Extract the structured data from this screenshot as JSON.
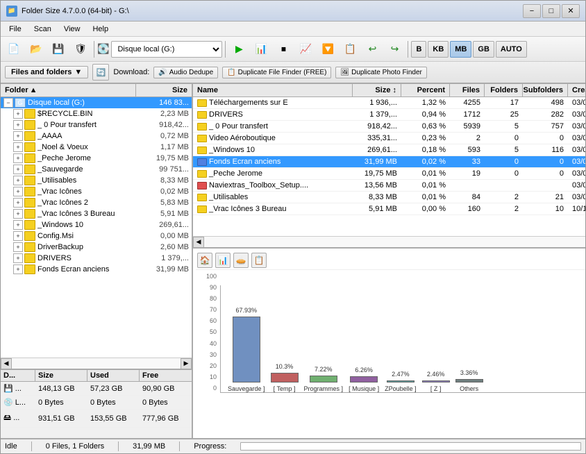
{
  "window": {
    "title": "Folder Size 4.7.0.0 (64-bit) - G:\\"
  },
  "menu": {
    "items": [
      "File",
      "Scan",
      "View",
      "Help"
    ]
  },
  "toolbar": {
    "drive_label": "Disque local (G:)",
    "size_buttons": [
      "B",
      "KB",
      "MB",
      "GB",
      "AUTO"
    ],
    "active_size": "MB"
  },
  "toolbar2": {
    "files_folders_label": "Files and folders",
    "download_label": "Download:",
    "tools": [
      {
        "icon": "🔊",
        "label": "Audio Dedupe"
      },
      {
        "icon": "📋",
        "label": "Duplicate File Finder (FREE)"
      },
      {
        "icon": "🖼",
        "label": "Duplicate Photo Finder"
      }
    ]
  },
  "tree": {
    "columns": [
      "Folder",
      "Size"
    ],
    "items": [
      {
        "indent": 0,
        "name": "Disque local (G:)",
        "size": "146 83...",
        "expanded": true,
        "selected": true,
        "type": "drive"
      },
      {
        "indent": 1,
        "name": "$RECYCLE.BIN",
        "size": "2,23 MB",
        "expanded": false,
        "type": "folder"
      },
      {
        "indent": 1,
        "name": "_ 0 Pour transfert",
        "size": "918,42...",
        "expanded": false,
        "type": "folder"
      },
      {
        "indent": 1,
        "name": "_AAAA",
        "size": "0,72 MB",
        "expanded": false,
        "type": "folder"
      },
      {
        "indent": 1,
        "name": "_Noel & Voeux",
        "size": "1,17 MB",
        "expanded": false,
        "type": "folder"
      },
      {
        "indent": 1,
        "name": "_Peche Jerome",
        "size": "19,75 MB",
        "expanded": false,
        "type": "folder"
      },
      {
        "indent": 1,
        "name": "_Sauvegarde",
        "size": "99 751...",
        "expanded": false,
        "type": "folder"
      },
      {
        "indent": 1,
        "name": "_Utilisables",
        "size": "8,33 MB",
        "expanded": false,
        "type": "folder"
      },
      {
        "indent": 1,
        "name": "_Vrac Icônes",
        "size": "0,02 MB",
        "expanded": false,
        "type": "folder"
      },
      {
        "indent": 1,
        "name": "_Vrac Icônes 2",
        "size": "5,83 MB",
        "expanded": false,
        "type": "folder"
      },
      {
        "indent": 1,
        "name": "_Vrac Icônes 3 Bureau",
        "size": "5,91 MB",
        "expanded": false,
        "type": "folder"
      },
      {
        "indent": 1,
        "name": "_Windows 10",
        "size": "269,61...",
        "expanded": false,
        "type": "folder"
      },
      {
        "indent": 1,
        "name": "Config.Msi",
        "size": "0,00 MB",
        "expanded": false,
        "type": "folder"
      },
      {
        "indent": 1,
        "name": "DriverBackup",
        "size": "2,60 MB",
        "expanded": false,
        "type": "folder"
      },
      {
        "indent": 1,
        "name": "DRIVERS",
        "size": "1 379,...",
        "expanded": false,
        "type": "folder"
      },
      {
        "indent": 1,
        "name": "Fonds Ecran anciens",
        "size": "31,99 MB",
        "expanded": false,
        "type": "folder"
      }
    ]
  },
  "drives": {
    "columns": [
      "D...",
      "Size",
      "Used",
      "Free"
    ],
    "items": [
      {
        "name": "...",
        "size": "148,13 GB",
        "used": "57,23 GB",
        "free": "90,90 GB",
        "icon": "hdd"
      },
      {
        "name": "L...",
        "size": "0 Bytes",
        "used": "0 Bytes",
        "free": "0 Bytes",
        "icon": "cd"
      },
      {
        "name": "...",
        "size": "931,51 GB",
        "used": "153,55 GB",
        "free": "777,96 GB",
        "icon": "hdd2"
      }
    ]
  },
  "files": {
    "columns": [
      "Name",
      "Size ↕",
      "Percent",
      "Files",
      "Folders",
      "Subfolders",
      "Created"
    ],
    "items": [
      {
        "name": "Téléchargements sur E",
        "size": "1 936,...",
        "percent": "1,32 %",
        "files": "4255",
        "folders": "17",
        "subfolders": "498",
        "created": "03/0",
        "icon": "yellow"
      },
      {
        "name": "DRIVERS",
        "size": "1 379,...",
        "percent": "0,94 %",
        "files": "1712",
        "folders": "25",
        "subfolders": "282",
        "created": "03/0",
        "icon": "yellow"
      },
      {
        "name": "_ 0 Pour transfert",
        "size": "918,42...",
        "percent": "0,63 %",
        "files": "5939",
        "folders": "5",
        "subfolders": "757",
        "created": "03/0",
        "icon": "yellow"
      },
      {
        "name": "Video Aéroboutique",
        "size": "335,31...",
        "percent": "0,23 %",
        "files": "2",
        "folders": "0",
        "subfolders": "0",
        "created": "03/0",
        "icon": "yellow"
      },
      {
        "name": "_Windows 10",
        "size": "269,61...",
        "percent": "0,18 %",
        "files": "593",
        "folders": "5",
        "subfolders": "116",
        "created": "03/0",
        "icon": "yellow"
      },
      {
        "name": "Fonds Ecran anciens",
        "size": "31,99 MB",
        "percent": "0,02 %",
        "files": "33",
        "folders": "0",
        "subfolders": "0",
        "created": "03/0",
        "selected": true,
        "icon": "blue2"
      },
      {
        "name": "_Peche Jerome",
        "size": "19,75 MB",
        "percent": "0,01 %",
        "files": "19",
        "folders": "0",
        "subfolders": "0",
        "created": "03/0",
        "icon": "yellow"
      },
      {
        "name": "Naviextras_Toolbox_Setup....",
        "size": "13,56 MB",
        "percent": "0,01 %",
        "files": "",
        "folders": "",
        "subfolders": "",
        "created": "03/0",
        "icon": "x"
      },
      {
        "name": "_Utilisables",
        "size": "8,33 MB",
        "percent": "0,01 %",
        "files": "84",
        "folders": "2",
        "subfolders": "21",
        "created": "03/0",
        "icon": "yellow"
      },
      {
        "name": "_Vrac Icônes 3 Bureau",
        "size": "5,91 MB",
        "percent": "0,00 %",
        "files": "160",
        "folders": "2",
        "subfolders": "10",
        "created": "10/1",
        "icon": "yellow"
      }
    ]
  },
  "chart": {
    "y_labels": [
      "100",
      "90",
      "80",
      "70",
      "60",
      "50",
      "40",
      "30",
      "20",
      "10",
      "0"
    ],
    "bars": [
      {
        "label": "67.93%",
        "name": "Sauvegarde ]",
        "height": 67.93,
        "color": "#7090c0"
      },
      {
        "label": "10.3%",
        "name": "[ Temp ]",
        "height": 10.3,
        "color": "#c06060"
      },
      {
        "label": "7.22%",
        "name": "Programmes ]",
        "height": 7.22,
        "color": "#70b070"
      },
      {
        "label": "6.26%",
        "name": "[ Musique ]",
        "height": 6.26,
        "color": "#9060a0"
      },
      {
        "label": "2.47%",
        "name": "ZPoubelle ]",
        "height": 2.47,
        "color": "#60a0a0"
      },
      {
        "label": "2.46%",
        "name": "[ Z ]",
        "height": 2.46,
        "color": "#9080c0"
      },
      {
        "label": "3.36%",
        "name": "Others",
        "height": 3.36,
        "color": "#708080"
      }
    ]
  },
  "status": {
    "files": "0 Files, 1 Folders",
    "size": "31,99 MB",
    "progress_label": "Progress:"
  }
}
